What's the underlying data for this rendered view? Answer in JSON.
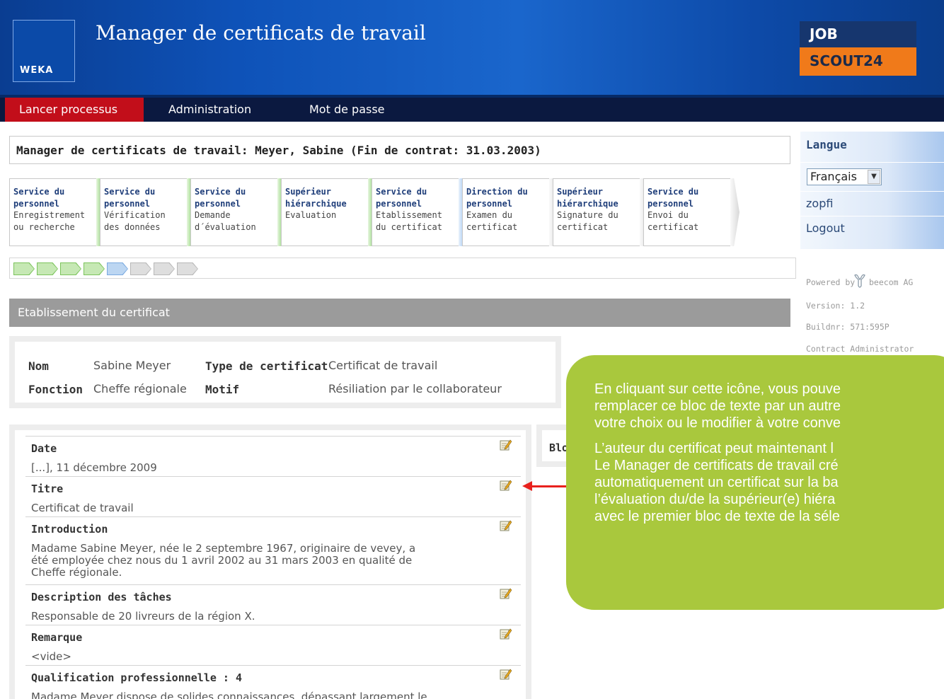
{
  "header": {
    "brand": "WEKA",
    "title": "Manager de certificats de travail",
    "partner_logo": {
      "line1": "JOB",
      "line2": "SCOUT24"
    }
  },
  "nav": {
    "items": [
      {
        "label": "Lancer processus",
        "active": true
      },
      {
        "label": "Administration",
        "active": false
      },
      {
        "label": "Mot de passe",
        "active": false
      }
    ]
  },
  "page_title": "Manager de certificats de travail: Meyer, Sabine (Fin de contrat: 31.03.2003)",
  "steps": [
    {
      "title": [
        "Service du",
        "personnel"
      ],
      "sub": [
        "Enregistrement",
        "ou recherche"
      ],
      "status": "done"
    },
    {
      "title": [
        "Service du",
        "personnel"
      ],
      "sub": [
        "Vérification",
        "des données"
      ],
      "status": "done"
    },
    {
      "title": [
        "Service du",
        "personnel"
      ],
      "sub": [
        "Demande",
        "d´évaluation"
      ],
      "status": "done"
    },
    {
      "title": [
        "Supérieur",
        "hiérarchique"
      ],
      "sub": [
        "Evaluation"
      ],
      "status": "done"
    },
    {
      "title": [
        "Service du",
        "personnel"
      ],
      "sub": [
        "Etablissement",
        "du certificat"
      ],
      "status": "current"
    },
    {
      "title": [
        "Direction du",
        "personnel"
      ],
      "sub": [
        "Examen du",
        "certificat"
      ],
      "status": "todo"
    },
    {
      "title": [
        "Supérieur",
        "hiérarchique"
      ],
      "sub": [
        "Signature du",
        "certificat"
      ],
      "status": "todo"
    },
    {
      "title": [
        "Service du",
        "personnel"
      ],
      "sub": [
        "Envoi du",
        "certificat"
      ],
      "status": "todo"
    }
  ],
  "progress": [
    "done",
    "done",
    "done",
    "done",
    "current",
    "todo",
    "todo",
    "todo"
  ],
  "colors": {
    "done_fill": "#c6e8b4",
    "done_border": "#7cc45c",
    "current_fill": "#bcd6f2",
    "current_border": "#7aaae0",
    "todo_fill": "#dedede",
    "todo_border": "#b8b8b8"
  },
  "section_title": "Etablissement du certificat",
  "info": {
    "nom_label": "Nom",
    "nom_value": "Sabine Meyer",
    "type_label": "Type de certificat",
    "type_value": "Certificat de travail",
    "fonction_label": "Fonction",
    "fonction_value": "Cheffe régionale",
    "motif_label": "Motif",
    "motif_value": "Résiliation par le collaborateur"
  },
  "fields": [
    {
      "label": "Date",
      "value": [
        "[...], 11 décembre 2009"
      ]
    },
    {
      "label": "Titre",
      "value": [
        "Certificat de travail"
      ]
    },
    {
      "label": "Introduction",
      "value": [
        "Madame Sabine Meyer, née le 2 septembre 1967, originaire de vevey, a",
        "été employée chez nous du 1 avril 2002 au 31 mars 2003 en qualité de",
        "Cheffe régionale."
      ]
    },
    {
      "label": "Description des tâches",
      "value": [
        "Responsable de 20 livreurs de la région X."
      ]
    },
    {
      "label": "Remarque",
      "value": [
        "<vide>"
      ]
    },
    {
      "label": "Qualification professionnelle : 4",
      "value": [
        "Madame Meyer dispose de solides connaissances, dépassant largement le"
      ]
    }
  ],
  "side_panel_label": "Blo",
  "sidebar": {
    "heading": "Langue",
    "language": "Français",
    "user": "zopfi",
    "logout": "Logout",
    "powered_by": "Powered by",
    "company": "beecom AG",
    "version": "Version: 1.2",
    "build": "Buildnr: 571:595P",
    "role": "Contract Administrator"
  },
  "callout": {
    "paragraph1": [
      "En cliquant sur cette icône, vous pouve",
      "remplacer ce bloc de texte par un autre",
      "votre choix ou le modifier à votre conve"
    ],
    "paragraph2": [
      "L’auteur du certificat peut maintenant l",
      "Le Manager de certificats de travail cré",
      "automatiquement un certificat sur la ba",
      "l’évaluation du/de la supérieur(e) hiéra",
      "avec le premier bloc de texte de la séle"
    ]
  }
}
